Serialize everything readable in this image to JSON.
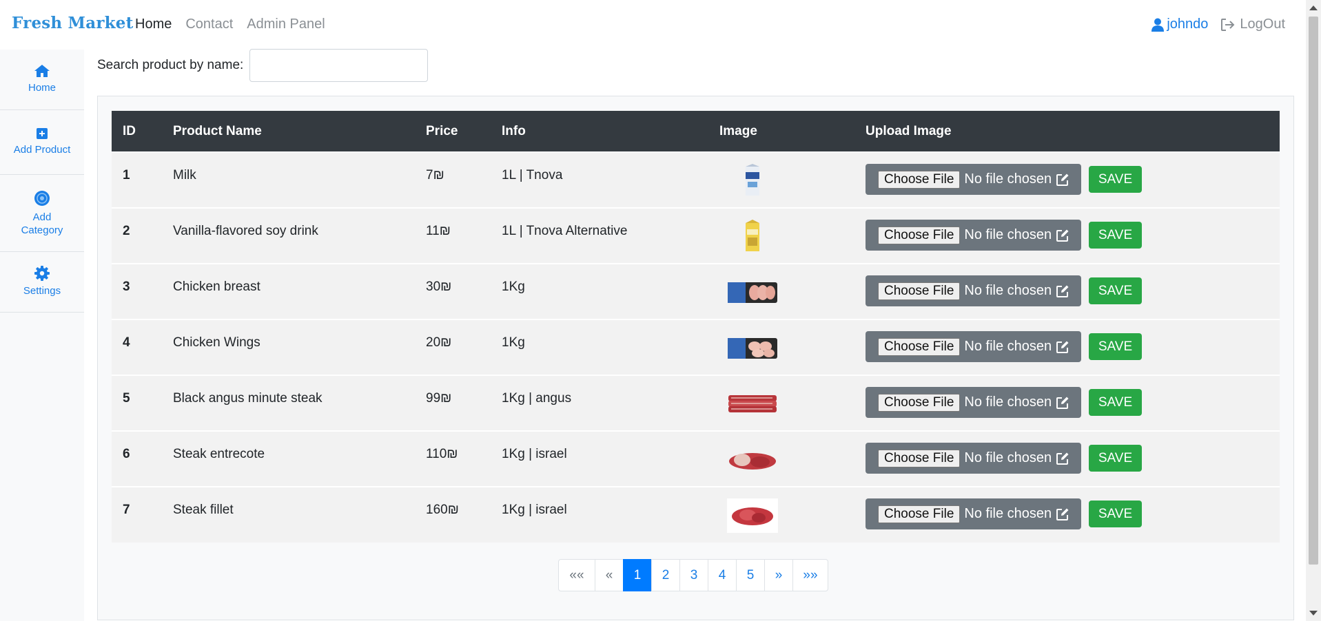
{
  "navbar": {
    "brand": "Fresh Market",
    "links": [
      "Home",
      "Contact",
      "Admin Panel"
    ],
    "user": "johndo",
    "logout": "LogOut"
  },
  "sidebar": {
    "items": [
      {
        "label": "Home",
        "icon": "home-icon"
      },
      {
        "label": "Add Product",
        "icon": "plus-square-icon"
      },
      {
        "label": "Add\nCategory",
        "label_line1": "Add",
        "label_line2": "Category",
        "icon": "category-icon"
      },
      {
        "label": "Settings",
        "icon": "gear-icon"
      }
    ]
  },
  "search": {
    "label": "Search product by name:",
    "value": "",
    "placeholder": ""
  },
  "table": {
    "headers": [
      "ID",
      "Product Name",
      "Price",
      "Info",
      "Image",
      "Upload Image"
    ],
    "rows": [
      {
        "id": "1",
        "name": "Milk",
        "price": "7₪",
        "info": "1L | Tnova",
        "image": "milk-carton"
      },
      {
        "id": "2",
        "name": "Vanilla-flavored soy drink",
        "price": "11₪",
        "info": "1L | Tnova Alternative",
        "image": "soy-drink-carton"
      },
      {
        "id": "3",
        "name": "Chicken breast",
        "price": "30₪",
        "info": "1Kg",
        "image": "chicken-breast-pack"
      },
      {
        "id": "4",
        "name": "Chicken Wings",
        "price": "20₪",
        "info": "1Kg",
        "image": "chicken-wings-pack"
      },
      {
        "id": "5",
        "name": "Black angus minute steak",
        "price": "99₪",
        "info": "1Kg | angus",
        "image": "angus-steak"
      },
      {
        "id": "6",
        "name": "Steak entrecote",
        "price": "110₪",
        "info": "1Kg | israel",
        "image": "entrecote-steak"
      },
      {
        "id": "7",
        "name": "Steak fillet",
        "price": "160₪",
        "info": "1Kg | israel",
        "image": "fillet-steak"
      }
    ],
    "choose_file": "Choose File",
    "no_file": "No file chosen",
    "save": "SAVE"
  },
  "pagination": {
    "first": "««",
    "prev": "«",
    "pages": [
      "1",
      "2",
      "3",
      "4",
      "5"
    ],
    "current": "1",
    "next": "»",
    "last": "»»"
  },
  "colors": {
    "brand": "#2f8fd8",
    "link": "#1a7ee6",
    "table_header": "#343a40",
    "upload_box": "#6c757d",
    "save": "#28a745",
    "page_active": "#007bff"
  }
}
